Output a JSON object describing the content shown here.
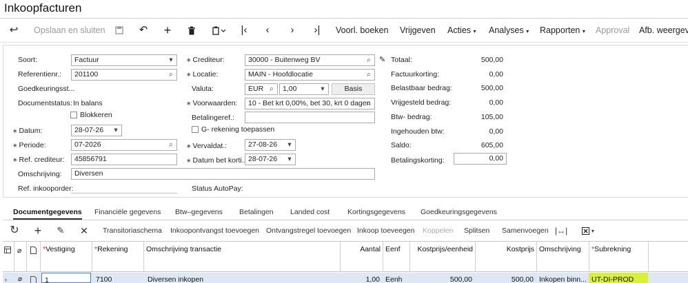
{
  "title": "Inkoopfacturen",
  "toolbar": {
    "save_close": "Opslaan en sluiten",
    "prelim_post": "Voorl. boeken",
    "release": "Vrijgeven",
    "actions": "Acties",
    "analyses": "Analyses",
    "reports": "Rapporten",
    "approval": "Approval",
    "display": "Afb. weergeve"
  },
  "form": {
    "type_label": "Soort:",
    "type_value": "Factuur",
    "ref_label": "Referentienr.:",
    "ref_value": "201100",
    "approval_status_label": "Goedkeuringsst...",
    "doc_status_label": "Documentstatus:",
    "doc_status_value": "In balans",
    "block_label": "Blokkeren",
    "date_label": "Datum:",
    "date_value": "28-07-26",
    "period_label": "Periode:",
    "period_value": "07-2026",
    "ref_creditor_label": "Ref. crediteur:",
    "ref_creditor_value": "45856791",
    "description_label": "Omschrijving:",
    "description_value": "Diversen",
    "ref_purchase_order_label": "Ref. inkooporder:",
    "creditor_label": "Crediteur:",
    "creditor_value": "30000 - Buitenweg BV",
    "location_label": "Locatie:",
    "location_value": "MAIN - Hoofdlocatie",
    "currency_label": "Valuta:",
    "currency_value": "EUR",
    "rate_value": "1,00",
    "basis_label": "Basis",
    "terms_label": "Voorwaarden:",
    "terms_value": "10 - Bet krt 0,00%, bet 30, krt 0 dagen",
    "payment_ref_label": "Betalingeref.:",
    "g_account_label": "G- rekening toepassen",
    "due_date_label": "Vervaldat.:",
    "due_date_value": "27-08-26",
    "discount_date_label": "Datum bet korti...",
    "discount_date_value": "28-07-26",
    "autopay_label": "Status AutoPay:"
  },
  "totals": [
    {
      "label": "Totaal:",
      "value": "500,00"
    },
    {
      "label": "Factuurkorting:",
      "value": "0,00"
    },
    {
      "label": "Belastbaar bedrag:",
      "value": "500,00"
    },
    {
      "label": "Vrijgesteld bedrag:",
      "value": "0,00"
    },
    {
      "label": "Btw- bedrag:",
      "value": "105,00"
    },
    {
      "label": "Ingehouden btw:",
      "value": "0,00"
    },
    {
      "label": "Saldo:",
      "value": "605,00"
    }
  ],
  "payment_discount": {
    "label": "Betalingskorting:",
    "value": "0,00"
  },
  "tabs": [
    "Documentgegevens",
    "Financiële gegevens",
    "Btw–gegevens",
    "Betalingen",
    "Landed cost",
    "Kortingsgegevens",
    "Goedkeuringsgegevens"
  ],
  "grid_toolbar": {
    "transit": "Transitoriaschema",
    "receipt_add": "Inkoopontvangst toevoegen",
    "receipt_line_add": "Ontvangstregel toevoegen",
    "purchase_add": "Inkoop toeveegen",
    "link": "Koppelen",
    "split": "Splitsen",
    "merge": "Samenvoegen"
  },
  "grid": {
    "headers": [
      "Vestiging",
      "Rekening",
      "Omschrijving transactie",
      "Aantal",
      "Eenf",
      "Kostprijs/eenheid",
      "Kostprijs",
      "Omschrijving",
      "Subrekning"
    ],
    "row": [
      "1",
      "7100",
      "Diversen inkopen",
      "1,00",
      "Eenh",
      "500,00",
      "500,00",
      "Inkopen binn...",
      "UT-DI-PROD"
    ]
  },
  "colors": {
    "accent_highlight": "#d9f03a",
    "row_selected": "#dde8f4"
  }
}
